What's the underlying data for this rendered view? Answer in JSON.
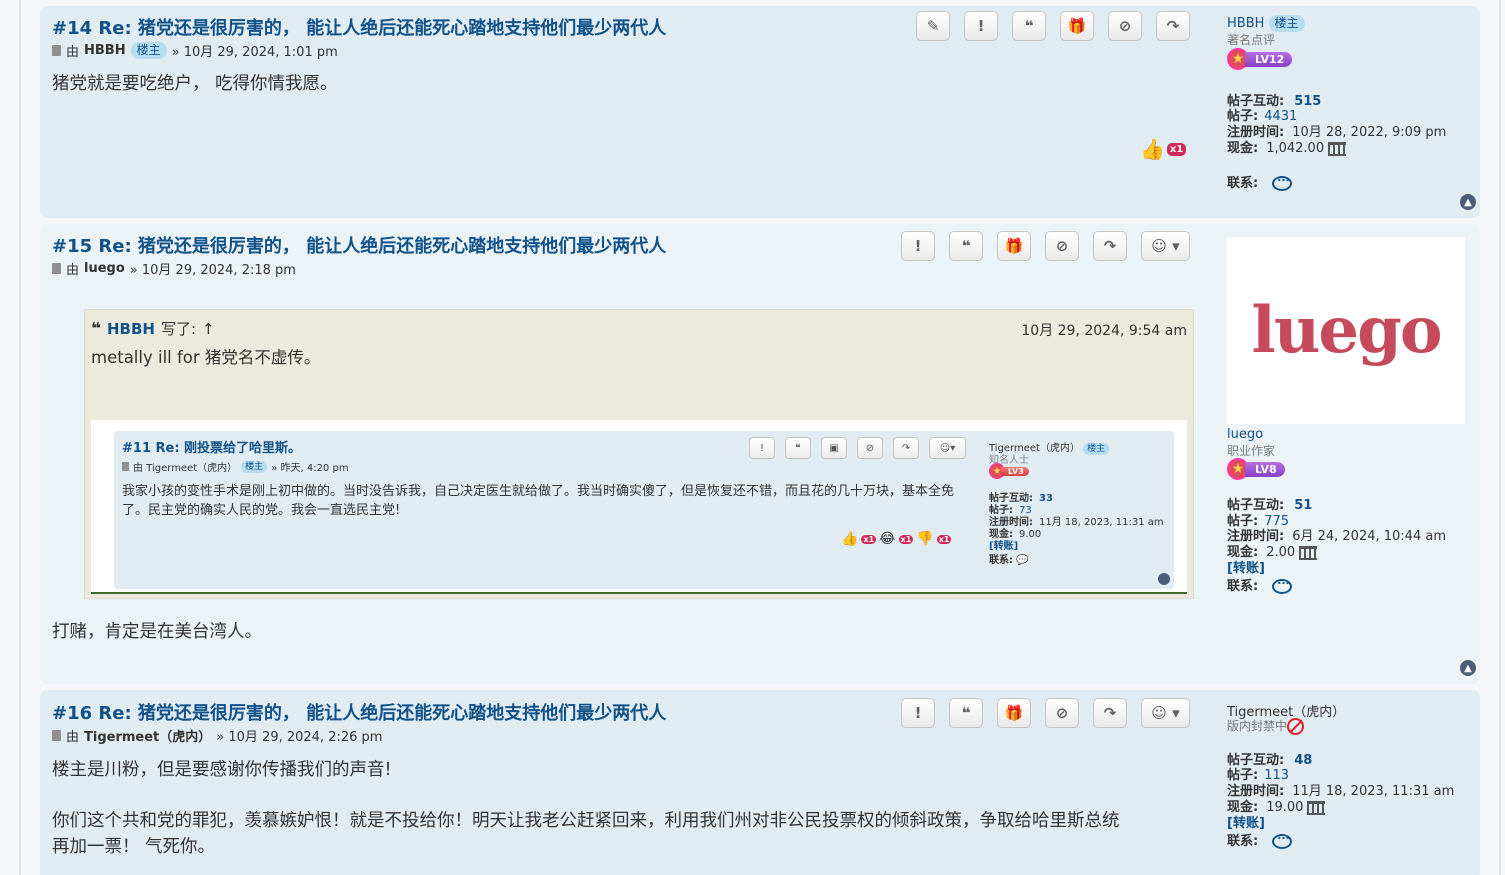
{
  "colors": {
    "post_bg": "#e1ebf2",
    "post_bg_alt": "#ecf3f7",
    "link": "#105289",
    "quote_bg": "#ebeadd"
  },
  "posts": [
    {
      "title": "#14 Re: 猪党还是很厉害的， 能让人绝后还能死心踏地支持他们最少两代人",
      "meta_prefix": "由",
      "author": "HBBH",
      "author_badge": "楼主",
      "date": "» 10月 29, 2024, 1:01 pm",
      "body": "猪党就是要吃绝户， 吃得你情我愿。",
      "reaction_count": "x1",
      "profile": {
        "username": "HBBH",
        "badge": "楼主",
        "rank": "著名点评",
        "level": "LV12",
        "interactions_label": "帖子互动:",
        "interactions": "515",
        "posts_label": "帖子:",
        "posts": "4431",
        "joined_label": "注册时间:",
        "joined": "10月 28, 2022, 9:09 pm",
        "cash_label": "现金:",
        "cash": "1,042.00",
        "contact_label": "联系:"
      }
    },
    {
      "title": "#15 Re: 猪党还是很厉害的， 能让人绝后还能死心踏地支持他们最少两代人",
      "meta_prefix": "由",
      "author": "luego",
      "date": "» 10月 29, 2024, 2:18 pm",
      "quote": {
        "author": "HBBH",
        "wrote": "写了:",
        "arrow": "↑",
        "date": "10月 29, 2024, 9:54 am",
        "text": "metally ill for 猪党名不虚传。",
        "embedded": {
          "title": "#11 Re: 刚投票给了哈里斯。",
          "meta": "由 Tigermeet（虎内）",
          "badge": "楼主",
          "date": "» 昨天, 4:20 pm",
          "body": "我家小孩的变性手术是刚上初中做的。当时没告诉我，自己决定医生就给做了。我当时确实傻了，但是恢复还不错，而且花的几十万块，基本全免了。民主党的确实人民的党。我会一直选民主党!",
          "reactions": [
            "x1",
            "x1",
            "x1"
          ],
          "profile": {
            "username": "Tigermeet（虎内）",
            "badge": "楼主",
            "rank": "知名人士",
            "level": "LV3",
            "interactions": "帖子互动:",
            "interactions_val": "33",
            "posts": "帖子:",
            "posts_val": "73",
            "joined": "注册时间:",
            "joined_val": "11月 18, 2023, 11:31 am",
            "cash": "现金:",
            "cash_val": "9.00",
            "transfer": "[转账]",
            "contact": "联系:"
          }
        }
      },
      "body": "打赌，肯定是在美台湾人。",
      "profile": {
        "avatar_text": "luego",
        "username": "luego",
        "rank": "职业作家",
        "level": "LV8",
        "interactions_label": "帖子互动:",
        "interactions": "51",
        "posts_label": "帖子:",
        "posts": "775",
        "joined_label": "注册时间:",
        "joined": "6月 24, 2024, 10:44 am",
        "cash_label": "现金:",
        "cash": "2.00",
        "transfer": "[转账]",
        "contact_label": "联系:"
      }
    },
    {
      "title": "#16 Re: 猪党还是很厉害的， 能让人绝后还能死心踏地支持他们最少两代人",
      "meta_prefix": "由",
      "author": "Tigermeet（虎内）",
      "date": "» 10月 29, 2024, 2:26 pm",
      "body_line1": "楼主是川粉，但是要感谢你传播我们的声音!",
      "body_line2": "你们这个共和党的罪犯，羡慕嫉妒恨！就是不投给你！明天让我老公赶紧回来，利用我们州对非公民投票权的倾斜政策，争取给哈里斯总统",
      "body_line3": "再加一票！ 气死你。",
      "profile": {
        "username": "Tigermeet（虎内）",
        "rank": "版内封禁中",
        "interactions_label": "帖子互动:",
        "interactions": "48",
        "posts_label": "帖子:",
        "posts": "113",
        "joined_label": "注册时间:",
        "joined": "11月 18, 2023, 11:31 am",
        "cash_label": "现金:",
        "cash": "19.00",
        "transfer": "[转账]",
        "contact_label": "联系:"
      }
    }
  ],
  "buttons": {
    "edit": "✎",
    "report": "!",
    "quote": "❝",
    "gift": "🎁",
    "ban": "⊘",
    "share": "↷",
    "react": "☺ ▾"
  }
}
